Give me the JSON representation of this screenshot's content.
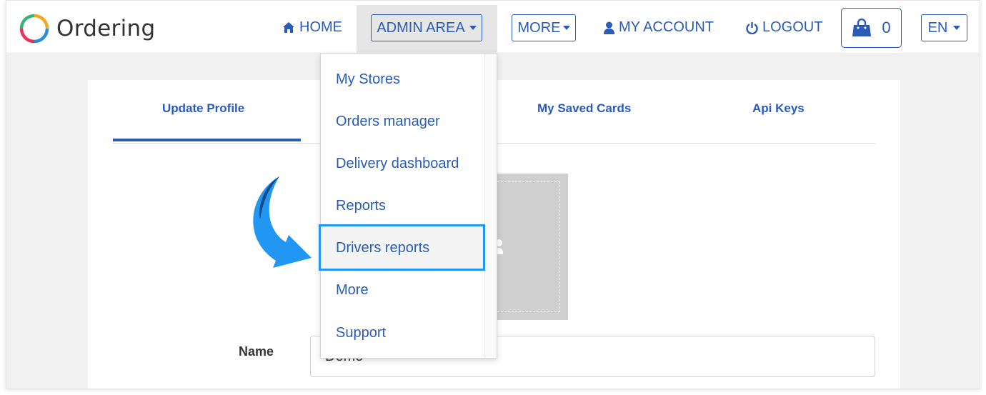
{
  "app": {
    "logo_text": "Ordering"
  },
  "nav": {
    "home": "HOME",
    "admin_area": "ADMIN AREA",
    "more": "MORE",
    "my_account": "MY ACCOUNT",
    "logout": "LOGOUT",
    "cart_count": "0",
    "language": "EN"
  },
  "tabs": [
    {
      "label": "Update Profile",
      "active": true
    },
    {
      "label": "My Saved Cards"
    },
    {
      "label": "Api Keys"
    }
  ],
  "dropdown": {
    "items": [
      {
        "label": "My Stores"
      },
      {
        "label": "Orders manager"
      },
      {
        "label": "Delivery dashboard"
      },
      {
        "label": "Reports"
      },
      {
        "label": "Drivers reports",
        "highlighted": true
      },
      {
        "label": "More"
      },
      {
        "label": "Support"
      }
    ]
  },
  "form": {
    "name_label": "Name",
    "name_value": "Demo"
  },
  "colors": {
    "accent": "#2a5bb8",
    "highlight": "#2196f3",
    "arrow": "#2196f3"
  },
  "icons": {
    "home": "home-icon",
    "user": "user-icon",
    "power": "power-icon",
    "cart": "shopping-bag-icon"
  }
}
